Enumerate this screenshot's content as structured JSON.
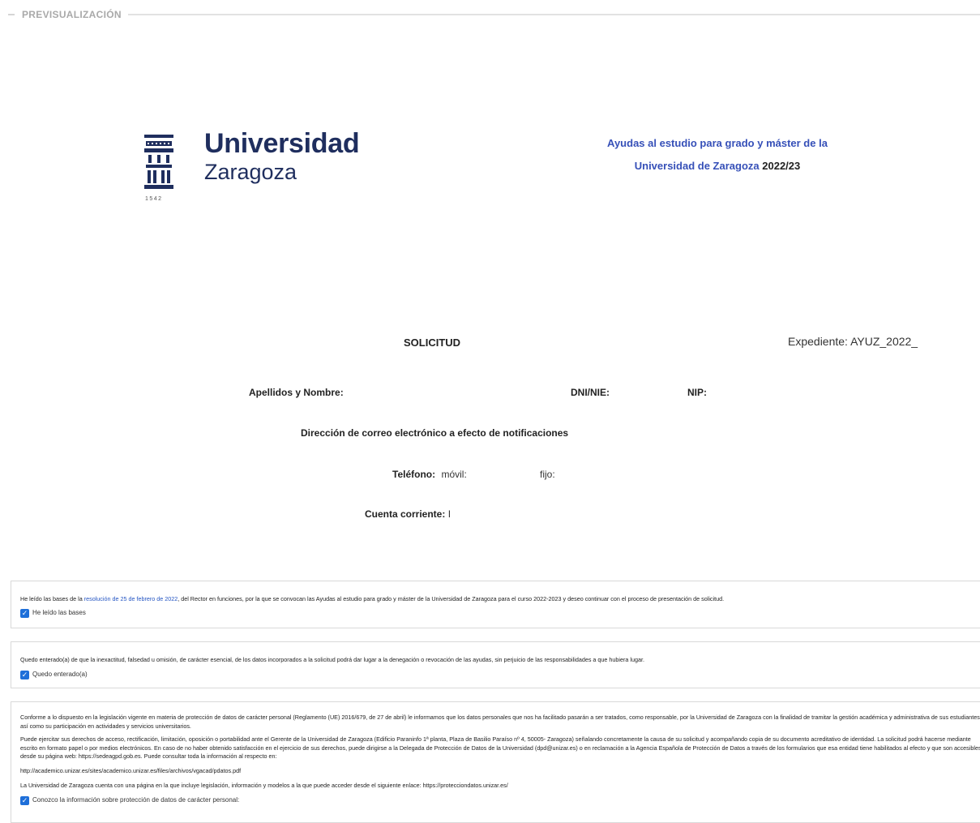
{
  "section": {
    "title": "PREVISUALIZACIÓN"
  },
  "logo": {
    "name": "Universidad",
    "sub": "Zaragoza",
    "year": "1542"
  },
  "header": {
    "title_line1": "Ayudas al estudio para grado y máster de la",
    "title_line2": "Universidad de Zaragoza",
    "title_year": "2022/23",
    "accent_color": "#3650b8"
  },
  "form": {
    "solicitud": "SOLICITUD",
    "expediente_label": "Expediente:",
    "expediente_value": "AYUZ_2022_",
    "apellidos_label": "Apellidos y Nombre:",
    "dni_label": "DNI/NIE:",
    "nip_label": "NIP:",
    "email_label": "Dirección de correo electrónico a efecto de notificaciones",
    "telefono_label": "Teléfono:",
    "movil_label": "móvil:",
    "fijo_label": "fijo:",
    "cuenta_label": "Cuenta corriente:",
    "cuenta_value": "I"
  },
  "bases": {
    "text_before": "He leído las bases de la ",
    "link": "resolución de 25 de febrero de 2022",
    "text_after": ", del Rector en funciones, por la que se convocan las Ayudas al estudio para grado y máster de la Universidad de Zaragoza para el curso 2022-2023 y deseo continuar con el proceso de presentación de solicitud.",
    "checkbox_label": "He leído las bases",
    "checked": true
  },
  "enterado": {
    "text": "Quedo enterado(a) de que la inexactitud, falsedad u omisión, de carácter esencial, de los datos incorporados a la solicitud podrá dar lugar a la denegación o revocación de las ayudas, sin perjuicio de las responsabilidades a que hubiera lugar.",
    "checkbox_label": "Quedo enterado(a)",
    "checked": true
  },
  "proteccion": {
    "p1": "Conforme a lo dispuesto en la legislación vigente en materia de protección de datos de carácter personal (Reglamento (UE) 2016/679, de 27 de abril) le informamos que los datos personales que nos ha facilitado pasarán a ser tratados, como responsable, por la Universidad de Zaragoza con la finalidad de tramitar la gestión académica y administrativa de sus estudiantes, así como su participación en actividades y servicios universitarios.",
    "p2": "Puede ejercitar sus derechos de acceso, rectificación, limitación, oposición o portabilidad ante el Gerente de la Universidad de Zaragoza (Edificio Paraninfo 1ª planta, Plaza de Basilio Paraíso nº 4, 50005- Zaragoza) señalando concretamente la causa de su solicitud y acompañando copia de su documento acreditativo de identidad. La solicitud podrá hacerse mediante escrito en formato papel o por medios electrónicos. En caso de no haber obtenido satisfacción en el ejercicio de sus derechos, puede dirigirse a la Delegada de Protección de Datos de la Universidad (dpd@unizar.es) o en reclamación a la Agencia Española de Protección de Datos a través de los formularios que esa entidad tiene habilitados al efecto y que son accesibles desde su página web: https://sedeagpd.gob.es. Puede consultar toda la información al respecto en:",
    "p3": "http://academico.unizar.es/sites/academico.unizar.es/files/archivos/vgacad/pdatos.pdf",
    "p4": "La Universidad de Zaragoza cuenta con una página en la que incluye legislación, información y modelos a la que puede acceder desde el siguiente enlace: https://protecciondatos.unizar.es/",
    "checkbox_label": "Conozco la información sobre protección de datos de carácter personal:",
    "checked": true
  }
}
